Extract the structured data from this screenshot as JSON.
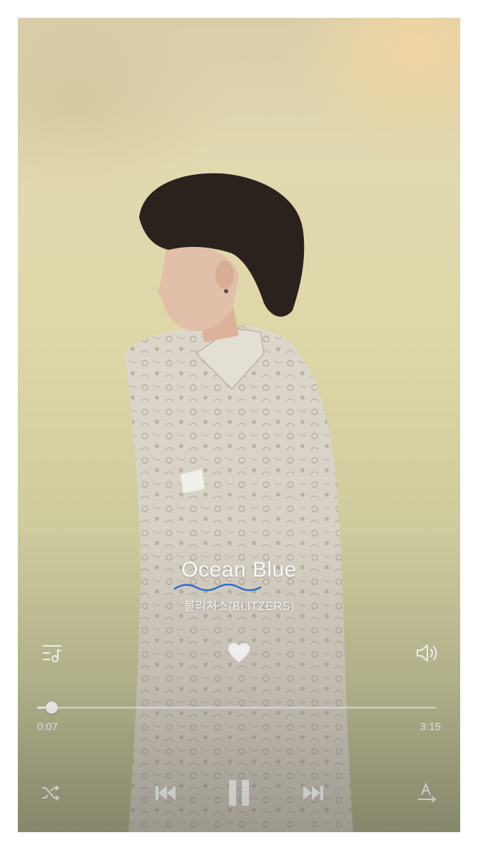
{
  "track": {
    "title": "Ocean Blue",
    "artist": "블리처스(BLITZERS)"
  },
  "progress": {
    "current": "0:07",
    "total": "3:15",
    "fraction": 0.036
  },
  "icons": {
    "lyrics": "lyrics-list-icon",
    "like": "heart-icon",
    "volume": "speaker-icon",
    "shuffle": "shuffle-icon",
    "previous": "previous-track-icon",
    "play_pause": "pause-icon",
    "next": "next-track-icon",
    "font_size": "text-size-icon"
  },
  "colors": {
    "controls": "#ffffff",
    "wave_accent": "#2f6fd6"
  }
}
